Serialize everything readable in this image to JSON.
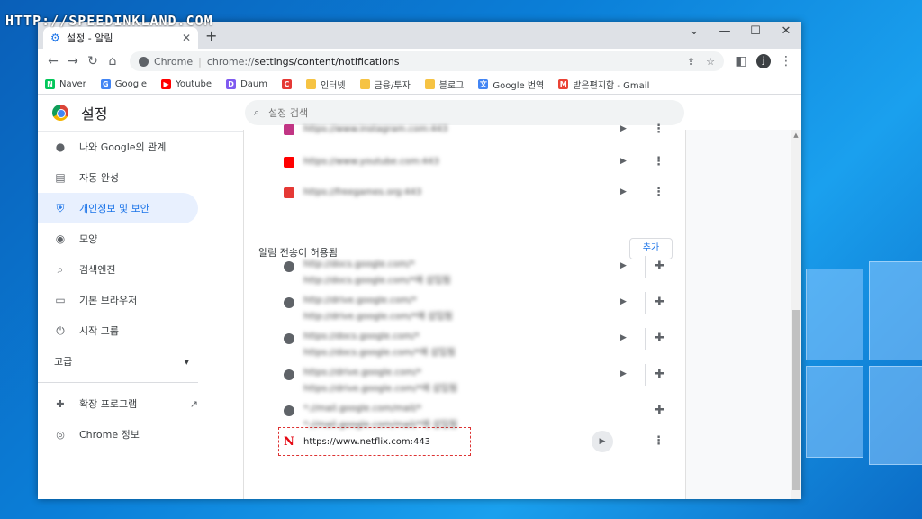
{
  "watermark": "HTTP://SPEEDINKLAND.COM",
  "tab": {
    "title": "설정 - 알림",
    "close": "✕",
    "new": "+"
  },
  "window_controls": {
    "min": "—",
    "max": "☐",
    "close": "✕",
    "dropdown": "⌄"
  },
  "omnibox": {
    "chrome_label": "Chrome",
    "separator": "|",
    "url_host": "chrome://",
    "url_path": "settings/content/notifications"
  },
  "profile_initial": "j",
  "bookmarks": [
    {
      "label": "Naver",
      "icon": "N",
      "color": "#03c75a"
    },
    {
      "label": "Google",
      "icon": "G",
      "color": "#4285f4"
    },
    {
      "label": "Youtube",
      "icon": "▶",
      "color": "#ff0000"
    },
    {
      "label": "Daum",
      "icon": "D",
      "color": "#7f5af0"
    },
    {
      "label": "",
      "icon": "C",
      "color": "#e53935"
    },
    {
      "label": "인터넷",
      "icon": "",
      "color": "#f6c343"
    },
    {
      "label": "금융/투자",
      "icon": "",
      "color": "#f6c343"
    },
    {
      "label": "블로그",
      "icon": "",
      "color": "#f6c343"
    },
    {
      "label": "Google 번역",
      "icon": "文",
      "color": "#4285f4"
    },
    {
      "label": "받은편지함 - Gmail",
      "icon": "M",
      "color": "#ea4335"
    }
  ],
  "settings": {
    "title": "설정",
    "search_placeholder": "설정 검색"
  },
  "sidebar": {
    "items": [
      {
        "label": "나와 Google의 관계",
        "icon": "person-icon"
      },
      {
        "label": "자동 완성",
        "icon": "clipboard-icon"
      },
      {
        "label": "개인정보 및 보안",
        "icon": "shield-icon",
        "active": true
      },
      {
        "label": "모양",
        "icon": "palette-icon"
      },
      {
        "label": "검색엔진",
        "icon": "search-icon"
      },
      {
        "label": "기본 브라우저",
        "icon": "browser-icon"
      },
      {
        "label": "시작 그룹",
        "icon": "power-icon"
      }
    ],
    "advanced": "고급",
    "extensions": "확장 프로그램",
    "about": "Chrome 정보"
  },
  "content": {
    "blocked_top": [
      {
        "url": "https://www.instagram.com:443",
        "color": "#c13584"
      },
      {
        "url": "https://www.youtube.com:443",
        "color": "#ff0000"
      },
      {
        "url": "https://freegames.org:443",
        "color": "#e53935"
      }
    ],
    "allowed_title": "알림 전송이 허용됨",
    "add_label": "추가",
    "allowed": [
      {
        "url": "http://docs.google.com/*",
        "sub": "http://docs.google.com/*에 삽입됨"
      },
      {
        "url": "http://drive.google.com/*",
        "sub": "http://drive.google.com/*에 삽입됨"
      },
      {
        "url": "https://docs.google.com/*",
        "sub": "https://docs.google.com/*에 삽입됨"
      },
      {
        "url": "https://drive.google.com/*",
        "sub": "https://drive.google.com/*에 삽입됨"
      },
      {
        "url": "*://mail.google.com/mail/*",
        "sub": "*://mail.google.com/mail/*에 삽입됨"
      }
    ],
    "netflix": {
      "logo": "N",
      "url": "https://www.netflix.com:443"
    }
  }
}
